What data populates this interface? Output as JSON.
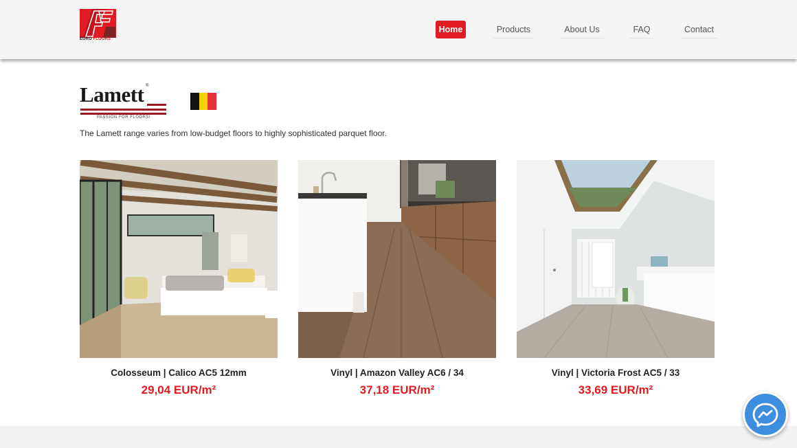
{
  "header": {
    "logo": {
      "line1": "EURO",
      "line2": "FLOORS",
      "color": "#e01b22"
    },
    "nav": [
      {
        "label": "Home",
        "active": true
      },
      {
        "label": "Products",
        "active": false
      },
      {
        "label": "About Us",
        "active": false
      },
      {
        "label": "FAQ",
        "active": false
      },
      {
        "label": "Contact",
        "active": false
      }
    ]
  },
  "brand": {
    "name": "Lamett",
    "registered": "®",
    "tagline": "PASSION FOR FLOORS!",
    "flag": "belgium-flag",
    "intro": "The Lamett range varies from low-budget floors to highly sophisticated parquet floor."
  },
  "products": [
    {
      "title": "Colosseum | Calico AC5 12mm",
      "price": "29,04 EUR/m²",
      "image": "bedroom-photo"
    },
    {
      "title": "Vinyl | Amazon Valley AC6 / 34",
      "price": "37,18 EUR/m²",
      "image": "kitchen-photo"
    },
    {
      "title": "Vinyl | Victoria Frost AC5 / 33",
      "price": "33,69 EUR/m²",
      "image": "bathroom-photo"
    }
  ],
  "colors": {
    "accent": "#e01b22",
    "brand_red": "#9b1b22",
    "messenger": "#3e8ee0"
  },
  "widgets": {
    "chat": "messenger-icon"
  }
}
